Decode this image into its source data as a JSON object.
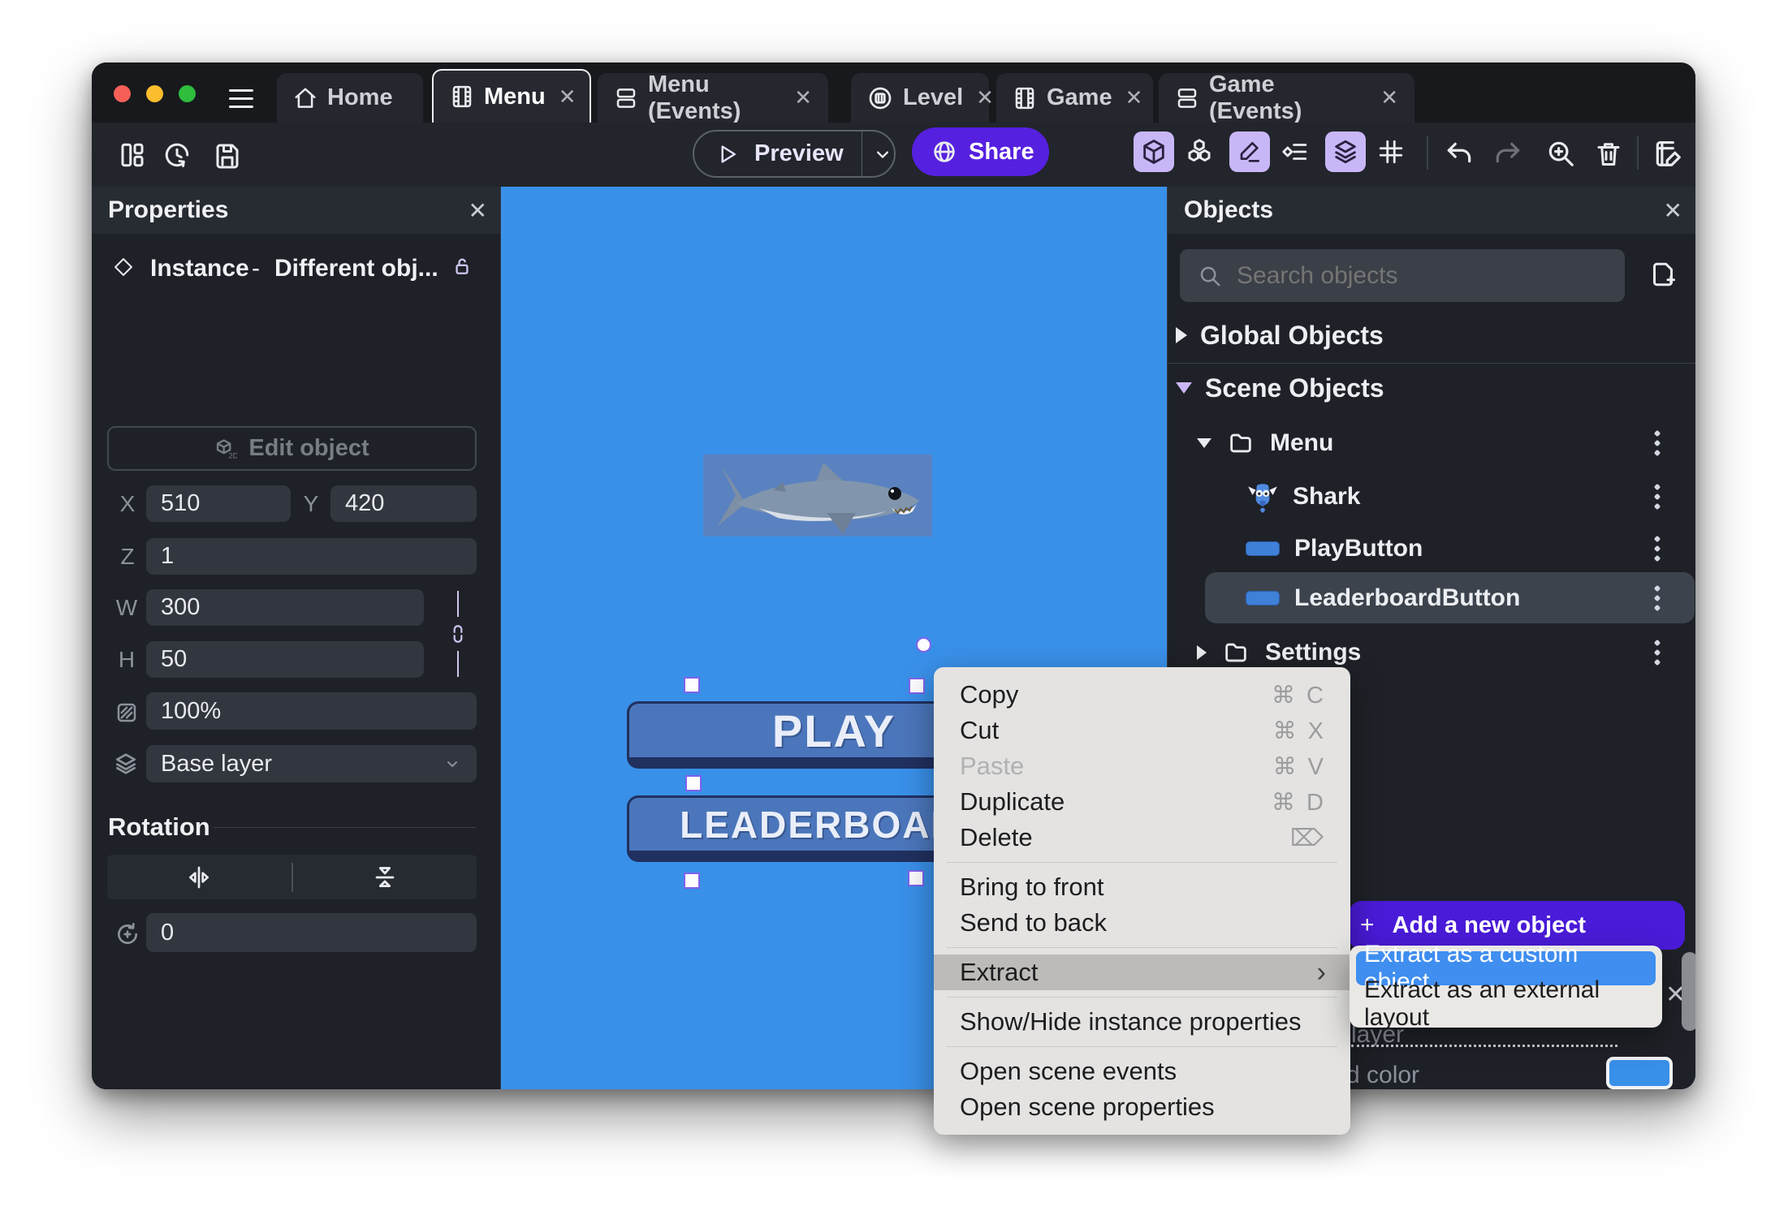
{
  "tabs": [
    {
      "label": "Home",
      "icon": "home-icon",
      "active": false,
      "closable": false
    },
    {
      "label": "Menu",
      "icon": "scene-icon",
      "active": true,
      "closable": true
    },
    {
      "label": "Menu (Events)",
      "icon": "events-icon",
      "active": false,
      "closable": true
    },
    {
      "label": "Level",
      "icon": "level-icon",
      "active": false,
      "closable": true
    },
    {
      "label": "Game",
      "icon": "scene-icon",
      "active": false,
      "closable": true
    },
    {
      "label": "Game (Events)",
      "icon": "events-icon",
      "active": false,
      "closable": true
    }
  ],
  "toolbar": {
    "preview_label": "Preview",
    "share_label": "Share"
  },
  "properties": {
    "title": "Properties",
    "instance_type": "Instance",
    "dash": "-",
    "instance_name": "Different obj...",
    "edit_object_label": "Edit object",
    "x_label": "X",
    "x": "510",
    "y_label": "Y",
    "y": "420",
    "z_label": "Z",
    "z": "1",
    "w_label": "W",
    "w": "300",
    "h_label": "H",
    "h": "50",
    "opacity": "100%",
    "layer": "Base layer",
    "rotation_title": "Rotation",
    "rotation": "0"
  },
  "canvas": {
    "play_label": "PLAY",
    "leaderboard_label": "LEADERBOARD"
  },
  "objects": {
    "title": "Objects",
    "search_placeholder": "Search objects",
    "global_label": "Global Objects",
    "scene_label": "Scene Objects",
    "tree": [
      {
        "label": "Menu",
        "type": "folder",
        "expanded": true
      },
      {
        "label": "Shark",
        "type": "sprite"
      },
      {
        "label": "PlayButton",
        "type": "button"
      },
      {
        "label": "LeaderboardButton",
        "type": "button",
        "selected": true
      },
      {
        "label": "Settings",
        "type": "folder",
        "expanded": false
      }
    ],
    "add_button_label": "Add a new object",
    "layer_panel": {
      "layer_text": "layer",
      "color_text": "d color",
      "swatch_color": "#3990e9"
    }
  },
  "context_menu": {
    "items": [
      {
        "label": "Copy",
        "shortcut": "⌘ C"
      },
      {
        "label": "Cut",
        "shortcut": "⌘ X"
      },
      {
        "label": "Paste",
        "shortcut": "⌘ V",
        "disabled": true
      },
      {
        "label": "Duplicate",
        "shortcut": "⌘ D"
      },
      {
        "label": "Delete",
        "shortcut": "⌦"
      },
      {
        "label": "Bring to front"
      },
      {
        "label": "Send to back"
      },
      {
        "label": "Extract",
        "highlighted": true,
        "arrow": "›"
      },
      {
        "label": "Show/Hide instance properties"
      },
      {
        "label": "Open scene events"
      },
      {
        "label": "Open scene properties"
      }
    ]
  },
  "submenu": {
    "items": [
      {
        "label": "Extract as a custom object",
        "selected": true
      },
      {
        "label": "Extract as an external layout"
      }
    ]
  },
  "colors": {
    "accent_purple": "#5620e0",
    "add_button_purple": "#4a1bd8",
    "canvas_blue": "#3990e9",
    "submenu_selected_blue": "#3f8ef0",
    "active_chip": "#c8b7f6",
    "selection_purple": "#7e62ea"
  }
}
